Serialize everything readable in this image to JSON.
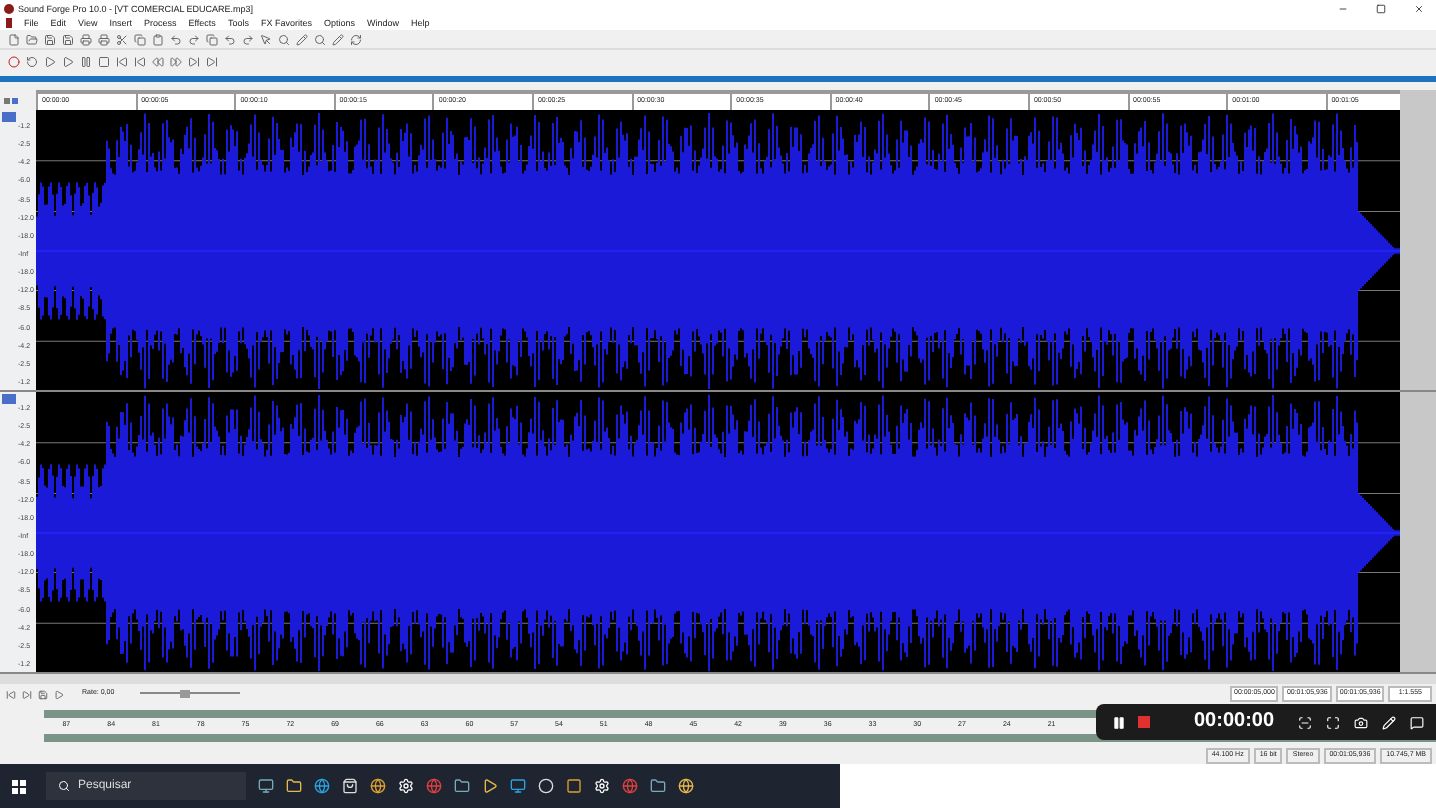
{
  "window": {
    "title": "Sound Forge Pro 10.0 - [VT COMERCIAL EDUCARE.mp3]"
  },
  "menu": [
    "File",
    "Edit",
    "View",
    "Insert",
    "Process",
    "Effects",
    "Tools",
    "FX Favorites",
    "Options",
    "Window",
    "Help"
  ],
  "ruler": [
    "00:00:00",
    "00:00:05",
    "00:00:10",
    "00:00:15",
    "00:00:20",
    "00:00:25",
    "00:00:30",
    "00:00:35",
    "00:00:40",
    "00:00:45",
    "00:00:50",
    "00:00:55",
    "00:01:00",
    "00:01:05"
  ],
  "channels": [
    {
      "scale": [
        "-1.2",
        "-2.5",
        "-4.2",
        "-6.0",
        "-8.5",
        "-12.0",
        "-18.0",
        "-Inf",
        "-18.0",
        "-12.0",
        "-8.5",
        "-6.0",
        "-4.2",
        "-2.5",
        "-1.2"
      ]
    },
    {
      "scale": [
        "-1.2",
        "-2.5",
        "-4.2",
        "-6.0",
        "-8.5",
        "-12.0",
        "-18.0",
        "-Inf",
        "-18.0",
        "-12.0",
        "-8.5",
        "-6.0",
        "-4.2",
        "-2.5",
        "-1.2"
      ]
    }
  ],
  "transport": {
    "rate": "Rate: 0,00",
    "rate_slider": {
      "level": 0.45
    },
    "selection": [
      "00:00:05,000",
      "00:01:05,936",
      "00:01:05,936"
    ],
    "zoom": "1:1.555"
  },
  "meter": [
    "87",
    "84",
    "81",
    "78",
    "75",
    "72",
    "69",
    "66",
    "63",
    "60",
    "57",
    "54",
    "51",
    "48",
    "45",
    "42",
    "39",
    "36",
    "33",
    "30",
    "27",
    "24",
    "21"
  ],
  "recorder": {
    "time": "00:00:00"
  },
  "status_bar": [
    "44.100 Hz",
    "16 bit",
    "Stereo",
    "00:01:05,936",
    "10.745,7 MB"
  ],
  "taskbar": {
    "search": {
      "placeholder": "Pesquisar"
    }
  }
}
